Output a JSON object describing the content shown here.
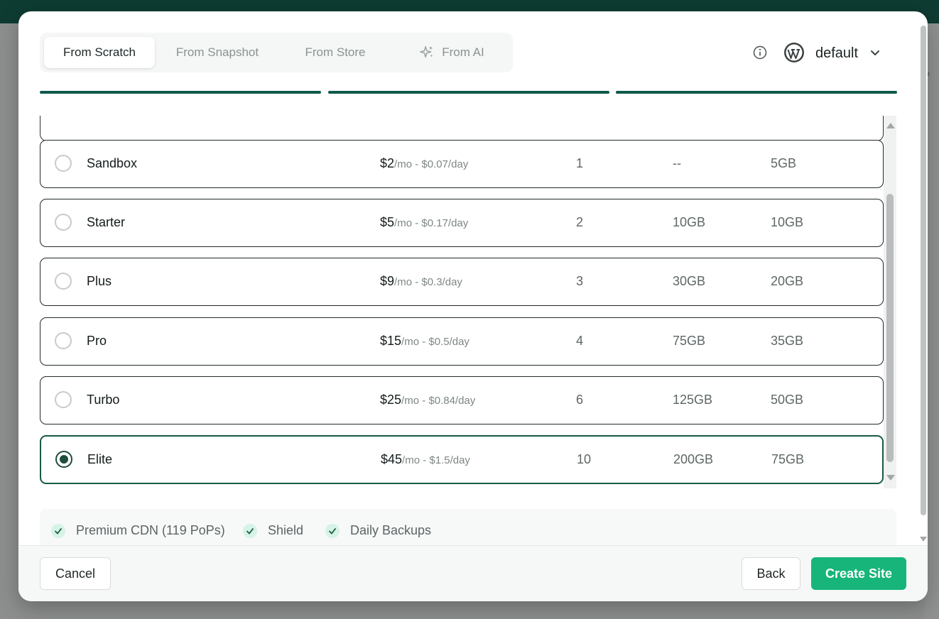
{
  "tabs": [
    {
      "label": "From Scratch",
      "active": true
    },
    {
      "label": "From Snapshot",
      "active": false
    },
    {
      "label": "From Store",
      "active": false
    },
    {
      "label": "From AI",
      "active": false,
      "icon": "sparkle-icon"
    }
  ],
  "header": {
    "profile_label": "default",
    "info_icon": "info-icon",
    "wordpress_icon": "wordpress-icon"
  },
  "plans": [
    {
      "name": "Sandbox",
      "price": "$2",
      "price_detail": "/mo - $0.07/day",
      "cpu": "1",
      "ssd": "--",
      "bandwidth": "5GB",
      "selected": false
    },
    {
      "name": "Starter",
      "price": "$5",
      "price_detail": "/mo - $0.17/day",
      "cpu": "2",
      "ssd": "10GB",
      "bandwidth": "10GB",
      "selected": false
    },
    {
      "name": "Plus",
      "price": "$9",
      "price_detail": "/mo - $0.3/day",
      "cpu": "3",
      "ssd": "30GB",
      "bandwidth": "20GB",
      "selected": false
    },
    {
      "name": "Pro",
      "price": "$15",
      "price_detail": "/mo - $0.5/day",
      "cpu": "4",
      "ssd": "75GB",
      "bandwidth": "35GB",
      "selected": false
    },
    {
      "name": "Turbo",
      "price": "$25",
      "price_detail": "/mo - $0.84/day",
      "cpu": "6",
      "ssd": "125GB",
      "bandwidth": "50GB",
      "selected": false
    },
    {
      "name": "Elite",
      "price": "$45",
      "price_detail": "/mo - $1.5/day",
      "cpu": "10",
      "ssd": "200GB",
      "bandwidth": "75GB",
      "selected": true
    }
  ],
  "features": [
    "Premium CDN (119 PoPs)",
    "Shield",
    "Daily Backups"
  ],
  "footer": {
    "cancel_label": "Cancel",
    "back_label": "Back",
    "create_label": "Create Site"
  },
  "colors": {
    "accent": "#17b57a",
    "dark_green": "#0e3b32",
    "progress": "#0e5a4a",
    "selected_border": "#1a5a43"
  }
}
